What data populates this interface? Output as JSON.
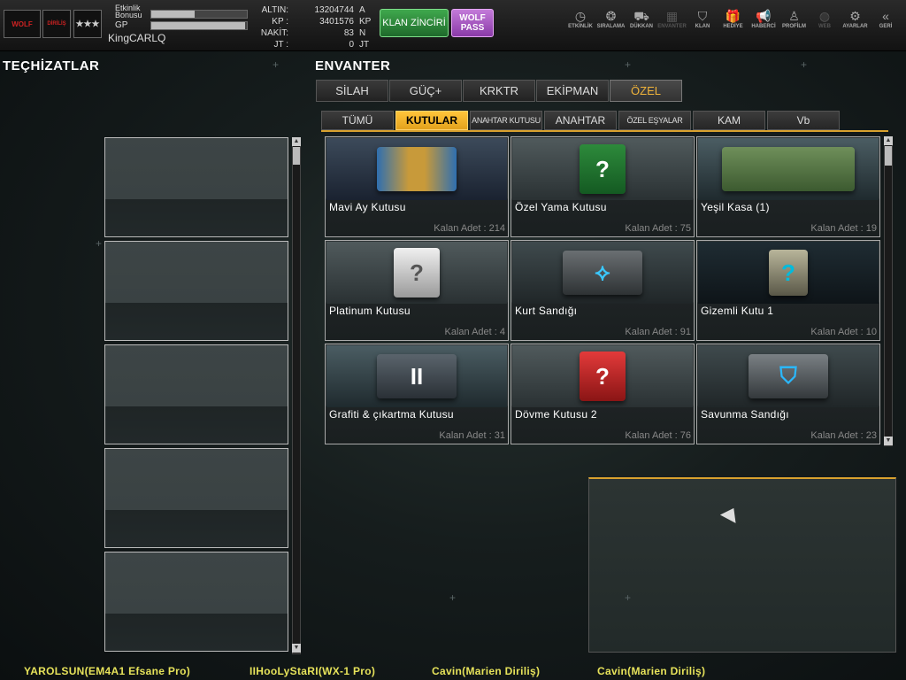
{
  "header": {
    "logo_text": "WOLF",
    "logo_sub": "DİRİLİŞ",
    "etkinlik_label": "Etkinlik\nBonusu",
    "etkinlik_fill": 0.45,
    "gp_label": "GP",
    "gp_fill": 0.98,
    "username": "KingCARLQ",
    "currencies": [
      {
        "label": "ALTIN:",
        "value": "13204744",
        "unit": "A"
      },
      {
        "label": "KP :",
        "value": "3401576",
        "unit": "KP"
      },
      {
        "label": "NAKİT:",
        "value": "83",
        "unit": "N"
      },
      {
        "label": "JT :",
        "value": "0",
        "unit": "JT"
      }
    ],
    "clan_button": "KLAN ZİNCİRİ",
    "wolf_pass_line1": "WOLF",
    "wolf_pass_line2": "PASS",
    "nav": [
      {
        "label": "ETKİNLİK",
        "icon": "clock-icon",
        "glyph": "◷"
      },
      {
        "label": "SIRALAMA",
        "icon": "medal-icon",
        "glyph": "❂"
      },
      {
        "label": "DÜKKAN",
        "icon": "cart-icon",
        "glyph": "⛟"
      },
      {
        "label": "ENVANTER",
        "icon": "inventory-icon",
        "glyph": "▦"
      },
      {
        "label": "KLAN",
        "icon": "shield-icon",
        "glyph": "⛉"
      },
      {
        "label": "HEDİYE",
        "icon": "gift-icon",
        "glyph": "🎁"
      },
      {
        "label": "HABERCİ",
        "icon": "megaphone-icon",
        "glyph": "📢"
      },
      {
        "label": "PROFİLM",
        "icon": "profile-icon",
        "glyph": "♙"
      },
      {
        "label": "WEB",
        "icon": "globe-icon",
        "glyph": "◍"
      },
      {
        "label": "AYARLAR",
        "icon": "gear-icon",
        "glyph": "⚙"
      },
      {
        "label": "GERİ",
        "icon": "back-icon",
        "glyph": "«"
      }
    ]
  },
  "left_title": "TEÇHİZATLAR",
  "right_title": "ENVANTER",
  "tabs": [
    "SİLAH",
    "GÜÇ+",
    "KRKTR",
    "EKİPMAN",
    "ÖZEL"
  ],
  "subtabs": [
    "TÜMÜ",
    "KUTULAR",
    "ANAHTAR KUTUSU",
    "ANAHTAR",
    "ÖZEL EŞYALAR",
    "KAM",
    "Vb"
  ],
  "items": [
    {
      "name": "Mavi Ay Kutusu",
      "count": "Kalan Adet : 214"
    },
    {
      "name": "Özel Yama Kutusu",
      "count": "Kalan Adet : 75"
    },
    {
      "name": "Yeşil Kasa (1)",
      "count": "Kalan Adet : 19"
    },
    {
      "name": "Platinum Kutusu",
      "count": "Kalan Adet : 4"
    },
    {
      "name": "Kurt Sandığı",
      "count": "Kalan Adet : 91"
    },
    {
      "name": "Gizemli Kutu 1",
      "count": "Kalan Adet : 10"
    },
    {
      "name": "Grafiti & çıkartma Kutusu",
      "count": "Kalan Adet : 31"
    },
    {
      "name": "Dövme Kutusu 2",
      "count": "Kalan Adet : 76"
    },
    {
      "name": "Savunma Sandığı",
      "count": "Kalan Adet : 23"
    }
  ],
  "footer": [
    "YAROLSUN(EM4A1 Efsane Pro)",
    "IIHooLyStaRI(WX-1 Pro)",
    "Cavin(Marien Diriliş)",
    "Cavin(Marien Diriliş)"
  ]
}
